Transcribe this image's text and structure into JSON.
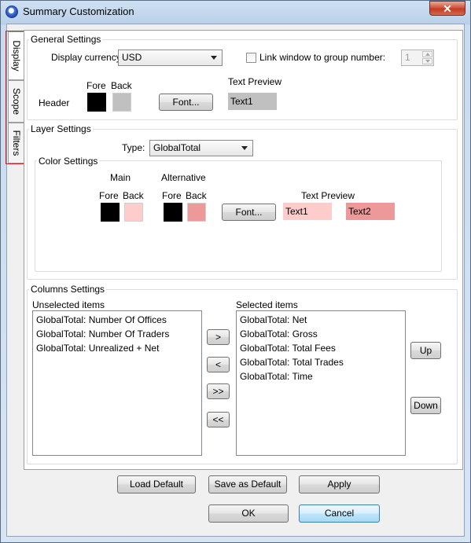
{
  "window": {
    "title": "Summary Customization",
    "close_glyph": "✕"
  },
  "tabs": [
    {
      "label": "Display",
      "active": true
    },
    {
      "label": "Scope",
      "active": false
    },
    {
      "label": "Filters",
      "active": false
    }
  ],
  "general": {
    "title": "General Settings",
    "currency_label": "Display currency:",
    "currency_value": "USD",
    "link_label": "Link window to group number:",
    "link_checked": false,
    "group_number": "1",
    "fore_label": "Fore",
    "back_label": "Back",
    "header_label": "Header",
    "font_button": "Font...",
    "text_preview_label": "Text Preview",
    "preview_text": "Text1",
    "header_fore_color": "#000000",
    "header_back_color": "#c0c0c0"
  },
  "layer": {
    "title": "Layer Settings",
    "type_label": "Type:",
    "type_value": "GlobalTotal",
    "color_title": "Color Settings",
    "main_label": "Main",
    "alt_label": "Alternative",
    "fore_label": "Fore",
    "back_label": "Back",
    "fore2_label": "Fore",
    "back2_label": "Back",
    "font_button": "Font...",
    "text_preview_label": "Text Preview",
    "preview1": "Text1",
    "preview2": "Text2",
    "main_fore_color": "#000000",
    "main_back_color": "#ffcccc",
    "alt_fore_color": "#000000",
    "alt_back_color": "#ee9999"
  },
  "columns": {
    "title": "Columns Settings",
    "unselected_label": "Unselected items",
    "selected_label": "Selected items",
    "unselected": [
      "GlobalTotal: Number Of Offices",
      "GlobalTotal: Number Of Traders",
      "GlobalTotal: Unrealized + Net"
    ],
    "selected": [
      "GlobalTotal: Net",
      "GlobalTotal: Gross",
      "GlobalTotal: Total Fees",
      "GlobalTotal: Total Trades",
      "GlobalTotal: Time"
    ],
    "add_btn": ">",
    "remove_btn": "<",
    "add_all_btn": ">>",
    "remove_all_btn": "<<",
    "up_btn": "Up",
    "down_btn": "Down"
  },
  "footer": {
    "load_default": "Load Default",
    "save_default": "Save as Default",
    "apply": "Apply",
    "ok": "OK",
    "cancel": "Cancel"
  }
}
